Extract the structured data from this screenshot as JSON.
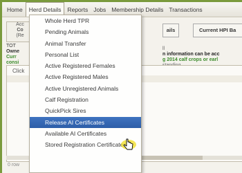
{
  "menubar": {
    "items": [
      "Home",
      "Herd Details",
      "Reports",
      "Jobs",
      "Membership Details",
      "Transactions"
    ],
    "active_index": 1
  },
  "dropdown": {
    "items": [
      "Whole Herd TPR",
      "Pending Animals",
      "Animal Transfer",
      "Personal List",
      "Active Registered Females",
      "Active Registered Males",
      "Active Unregistered Animals",
      "Calf Registration",
      "QuickPick Sires",
      "Release AI Certificates",
      "Available AI Certificates",
      "Stored Registration Certificates"
    ],
    "selected_index": 9
  },
  "background": {
    "left_box": [
      "Acc",
      "Co",
      "(Re"
    ],
    "tab_1": "ails",
    "tab_2": "Current HPI Ba",
    "info_left": [
      "TOT",
      "Owne",
      "Curr",
      "consi"
    ],
    "info_right_line1": "ll",
    "info_right_line2": "n information can be acc",
    "info_right_line3": "g 2014 calf crops or earl",
    "info_right_line4": "standing",
    "panel_label": "Click",
    "bottom_text": "0 row"
  },
  "colors": {
    "frame": "#7a9a3c",
    "selected_bg": "#3f73c0",
    "green_text": "#3a8a2a"
  }
}
